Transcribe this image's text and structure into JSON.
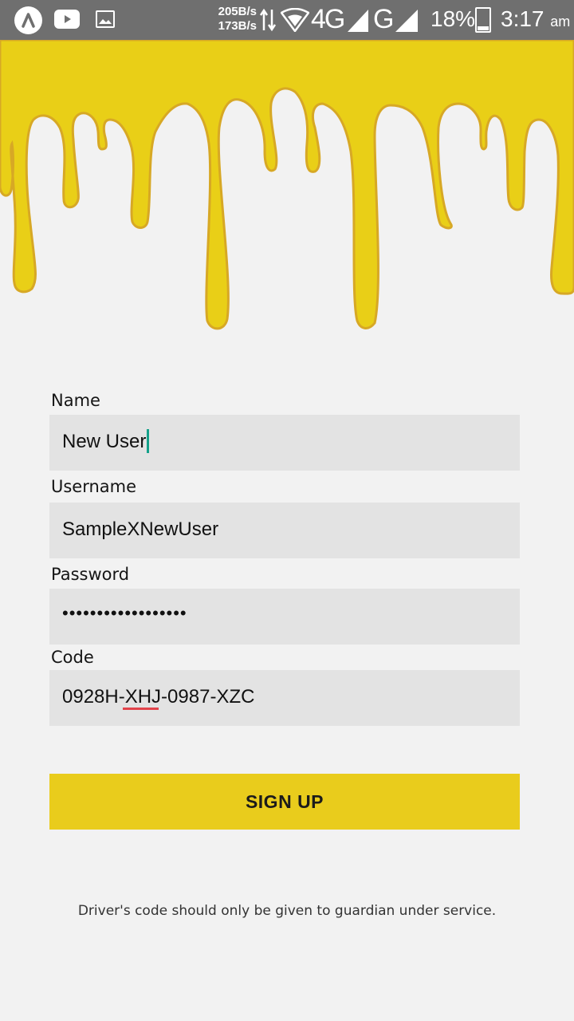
{
  "status_bar": {
    "speed_down": "205B/s",
    "speed_up": "173B/s",
    "network_primary": "4G",
    "network_secondary": "G",
    "battery": "18%",
    "time": "3:17",
    "ampm": "am",
    "icons": [
      "app-a-icon",
      "youtube-icon",
      "gallery-icon",
      "data-arrows-icon",
      "wifi-icon",
      "signal-icon",
      "battery-icon"
    ]
  },
  "form": {
    "name": {
      "label": "Name",
      "value": "New User"
    },
    "username": {
      "label": "Username",
      "value": "SampleXNewUser"
    },
    "password": {
      "label": "Password",
      "value": "••••••••••••••••••"
    },
    "code": {
      "label": "Code",
      "value": "0928H-XHJ-0987-XZC"
    }
  },
  "signup_label": "SIGN UP",
  "note": "Driver's code should only be given to guardian under service.",
  "colors": {
    "accent": "#e9cc1c",
    "status_bar": "#6f6f6f",
    "background": "#f2f2f2",
    "field_bg": "#e3e3e3",
    "cursor": "#14a08a"
  }
}
